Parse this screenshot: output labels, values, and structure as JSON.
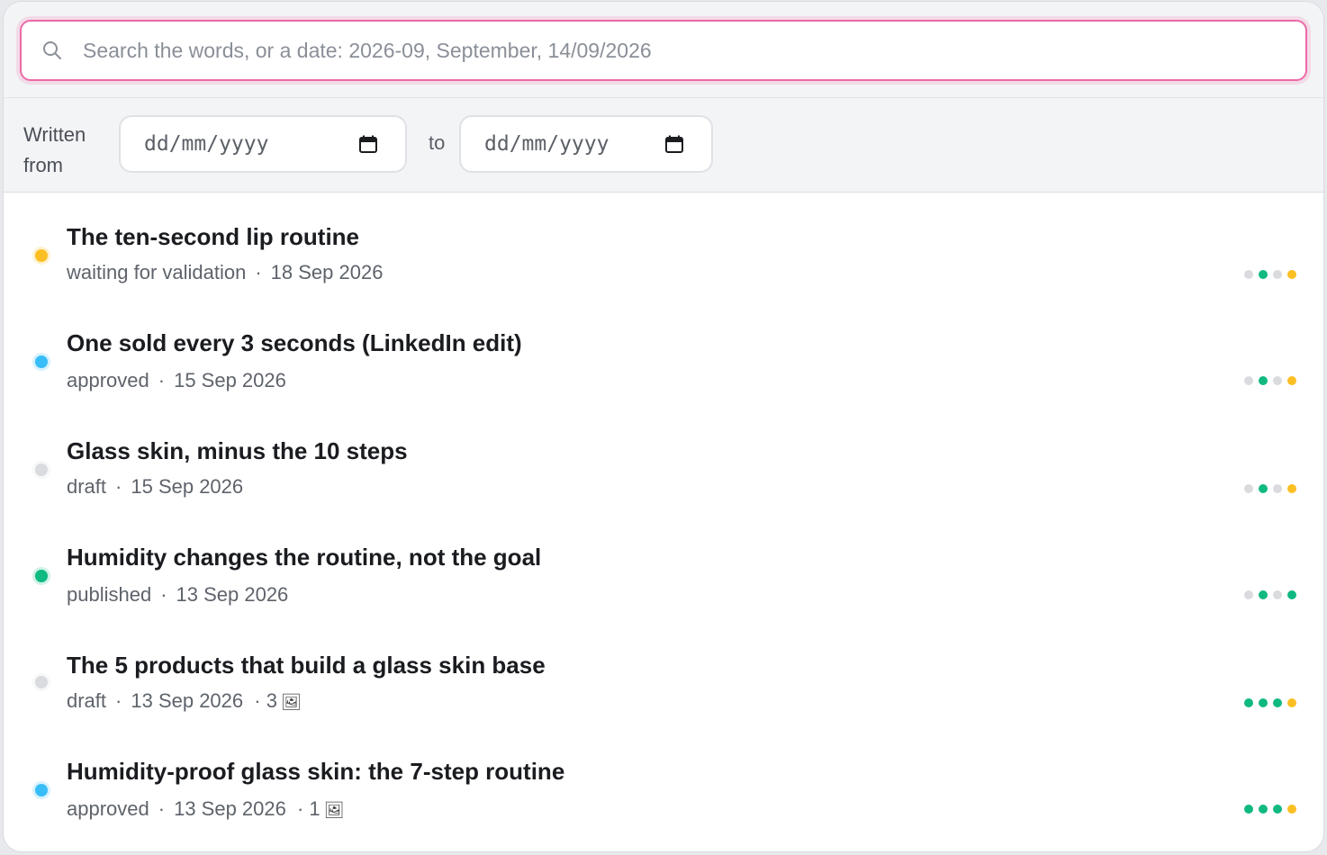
{
  "search": {
    "placeholder": "Search the words, or a date: 2026-09, September, 14/09/2026",
    "icon": "search-icon"
  },
  "filter": {
    "written_from_label": "Written from",
    "from_placeholder": "dd/mm/yyyy",
    "to_label": "to",
    "to_placeholder": "dd/mm/yyyy",
    "calendar_icon": "calendar-icon"
  },
  "colors": {
    "yellow": "#fbbf24",
    "blue": "#38bdf8",
    "grey": "#d9dbde",
    "green": "#10b981",
    "focus_ring": "#ec6aa7"
  },
  "posts": [
    {
      "title": "The ten-second lip routine",
      "status": "waiting for validation",
      "status_color": "#fbbf24",
      "date": "18 Sep 2026",
      "images": "",
      "steps": [
        "#d9dbde",
        "#10b981",
        "#d9dbde",
        "#fbbf24"
      ]
    },
    {
      "title": "One sold every 3 seconds (LinkedIn edit)",
      "status": "approved",
      "status_color": "#38bdf8",
      "date": "15 Sep 2026",
      "images": "",
      "steps": [
        "#d9dbde",
        "#10b981",
        "#d9dbde",
        "#fbbf24"
      ]
    },
    {
      "title": "Glass skin, minus the 10 steps",
      "status": "draft",
      "status_color": "#d9dbde",
      "date": "15 Sep 2026",
      "images": "",
      "steps": [
        "#d9dbde",
        "#10b981",
        "#d9dbde",
        "#fbbf24"
      ]
    },
    {
      "title": "Humidity changes the routine, not the goal",
      "status": "published",
      "status_color": "#10b981",
      "date": "13 Sep 2026",
      "images": "",
      "steps": [
        "#d9dbde",
        "#10b981",
        "#d9dbde",
        "#10b981"
      ]
    },
    {
      "title": "The 5 products that build a glass skin base",
      "status": "draft",
      "status_color": "#d9dbde",
      "date": "13 Sep 2026",
      "images": "3",
      "steps": [
        "#10b981",
        "#10b981",
        "#10b981",
        "#fbbf24"
      ]
    },
    {
      "title": "Humidity-proof glass skin: the 7-step routine",
      "status": "approved",
      "status_color": "#38bdf8",
      "date": "13 Sep 2026",
      "images": "1",
      "steps": [
        "#10b981",
        "#10b981",
        "#10b981",
        "#fbbf24"
      ]
    }
  ]
}
